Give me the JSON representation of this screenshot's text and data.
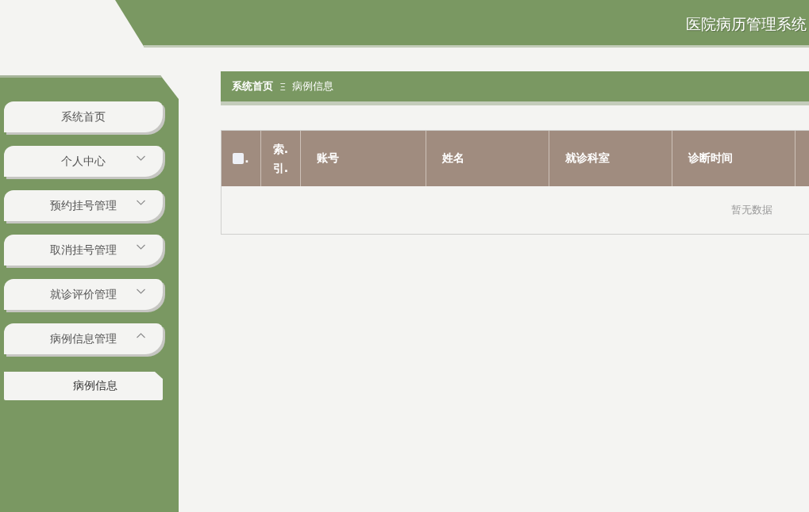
{
  "header": {
    "title": "医院病历管理系统"
  },
  "sidebar": {
    "items": [
      {
        "label": "系统首页",
        "kind": "link"
      },
      {
        "label": "个人中心",
        "kind": "submenu",
        "expanded": false
      },
      {
        "label": "预约挂号管理",
        "kind": "submenu",
        "expanded": false
      },
      {
        "label": "取消挂号管理",
        "kind": "submenu",
        "expanded": false
      },
      {
        "label": "就诊评价管理",
        "kind": "submenu",
        "expanded": false
      },
      {
        "label": "病例信息管理",
        "kind": "submenu",
        "expanded": true,
        "children": [
          {
            "label": "病例信息"
          }
        ]
      }
    ]
  },
  "breadcrumb": {
    "items": [
      {
        "label": "系统首页"
      },
      {
        "label": "病例信息"
      }
    ],
    "separator": "Ξ"
  },
  "table": {
    "select_all": {
      "label": ".",
      "checked": false
    },
    "columns": [
      "索.引.",
      "账号",
      "姓名",
      "就诊科室",
      "诊断时间"
    ],
    "empty_text": "暂无数据"
  }
}
